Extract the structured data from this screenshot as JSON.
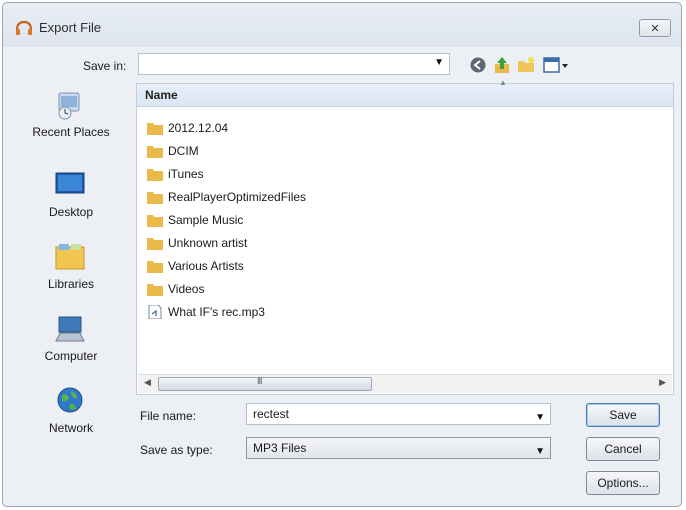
{
  "window": {
    "title": "Export File",
    "close_label": "✕"
  },
  "toolbar": {
    "save_in_label": "Save in:",
    "save_in_value": "",
    "icons": [
      "back-icon",
      "up-folder-icon",
      "new-folder-icon",
      "view-menu-icon"
    ]
  },
  "sidebar": {
    "items": [
      {
        "label": "Recent Places",
        "icon": "recent-places-icon"
      },
      {
        "label": "Desktop",
        "icon": "desktop-icon"
      },
      {
        "label": "Libraries",
        "icon": "libraries-icon"
      },
      {
        "label": "Computer",
        "icon": "computer-icon"
      },
      {
        "label": "Network",
        "icon": "network-icon"
      }
    ]
  },
  "file_list": {
    "column_header": "Name",
    "items": [
      {
        "name": "2012.12.04",
        "type": "folder"
      },
      {
        "name": "DCIM",
        "type": "folder"
      },
      {
        "name": "iTunes",
        "type": "folder"
      },
      {
        "name": "RealPlayerOptimizedFiles",
        "type": "folder"
      },
      {
        "name": "Sample Music",
        "type": "folder"
      },
      {
        "name": "Unknown artist",
        "type": "folder"
      },
      {
        "name": "Various Artists",
        "type": "folder"
      },
      {
        "name": "Videos",
        "type": "folder"
      },
      {
        "name": "What IF's rec.mp3",
        "type": "audio-file"
      }
    ],
    "scroll_grip": "III"
  },
  "form": {
    "file_name_label": "File name:",
    "file_name_value": "rectest",
    "save_type_label": "Save as type:",
    "save_type_value": "MP3 Files"
  },
  "buttons": {
    "save": "Save",
    "cancel": "Cancel",
    "options": "Options..."
  },
  "colors": {
    "folder": "#e9b94a",
    "header_bg": "#dde8f4",
    "window_bg": "#eceff4"
  }
}
